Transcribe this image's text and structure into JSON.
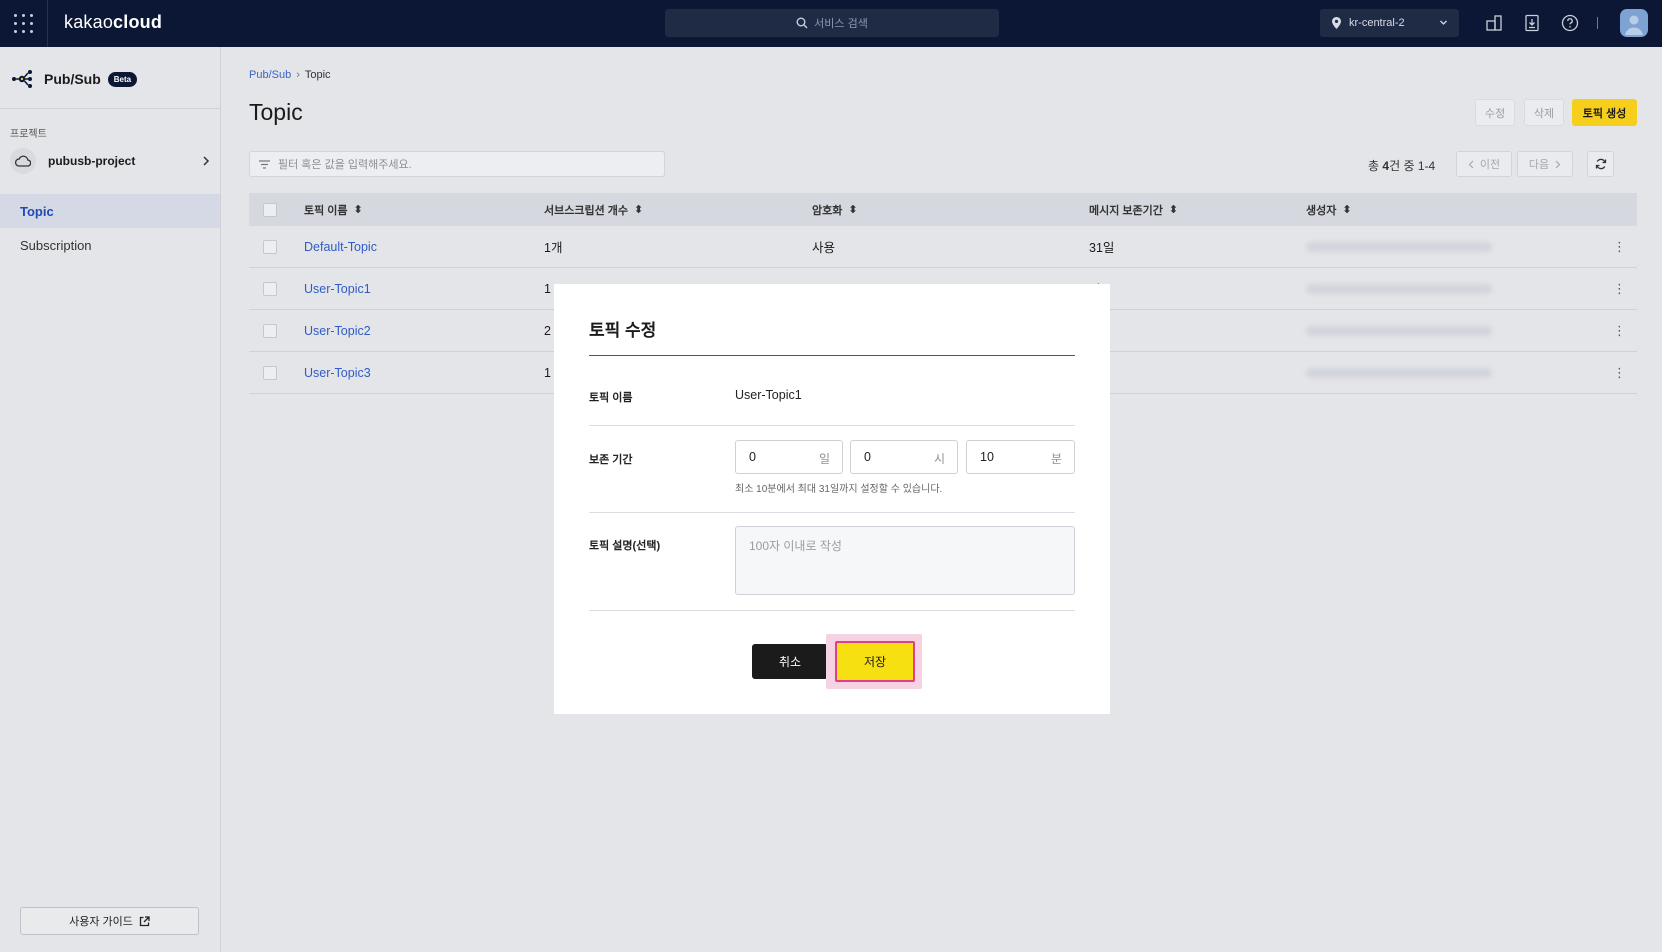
{
  "header": {
    "logo_light": "kakao",
    "logo_bold": "cloud",
    "search_placeholder": "서비스 검색",
    "region": "kr-central-2"
  },
  "sidebar": {
    "service_name": "Pub/Sub",
    "beta_badge": "Beta",
    "project_label": "프로젝트",
    "project_name": "pubusb-project",
    "nav": [
      {
        "label": "Topic",
        "active": true
      },
      {
        "label": "Subscription",
        "active": false
      }
    ],
    "guide_label": "사용자 가이드"
  },
  "main": {
    "breadcrumb": {
      "root": "Pub/Sub",
      "current": "Topic"
    },
    "title": "Topic",
    "actions": {
      "edit": "수정",
      "delete": "삭제",
      "create": "토픽 생성"
    },
    "filter_placeholder": "필터 혹은 값을 입력해주세요.",
    "pager": {
      "prefix": "총",
      "count": "4",
      "suffix": "건 중 1-4",
      "prev": "이전",
      "next": "다음"
    },
    "table": {
      "columns": [
        "토픽 이름",
        "서브스크립션 개수",
        "암호화",
        "메시지 보존기간",
        "생성자"
      ],
      "rows": [
        {
          "name": "Default-Topic",
          "subs": "1개",
          "enc": "사용",
          "retention": "31일"
        },
        {
          "name": "User-Topic1",
          "subs": "1",
          "enc": "",
          "retention": "일"
        },
        {
          "name": "User-Topic2",
          "subs": "2",
          "enc": "",
          "retention": ""
        },
        {
          "name": "User-Topic3",
          "subs": "1",
          "enc": "",
          "retention": ""
        }
      ]
    }
  },
  "modal": {
    "title": "토픽 수정",
    "name_label": "토픽 이름",
    "name_value": "User-Topic1",
    "retention_label": "보존 기간",
    "days": {
      "value": "0",
      "unit": "일"
    },
    "hours": {
      "value": "0",
      "unit": "시"
    },
    "minutes": {
      "value": "10",
      "unit": "분"
    },
    "retention_help": "최소 10분에서 최대 31일까지 설정할 수 있습니다.",
    "desc_label": "토픽 설명(선택)",
    "desc_placeholder": "100자 이내로 작성",
    "cancel": "취소",
    "save": "저장"
  },
  "colors": {
    "header_bg": "#0b1734",
    "accent_yellow": "#f5cf1b",
    "link_blue": "#2f5cc6",
    "highlight_pink": "#e13f8c"
  }
}
